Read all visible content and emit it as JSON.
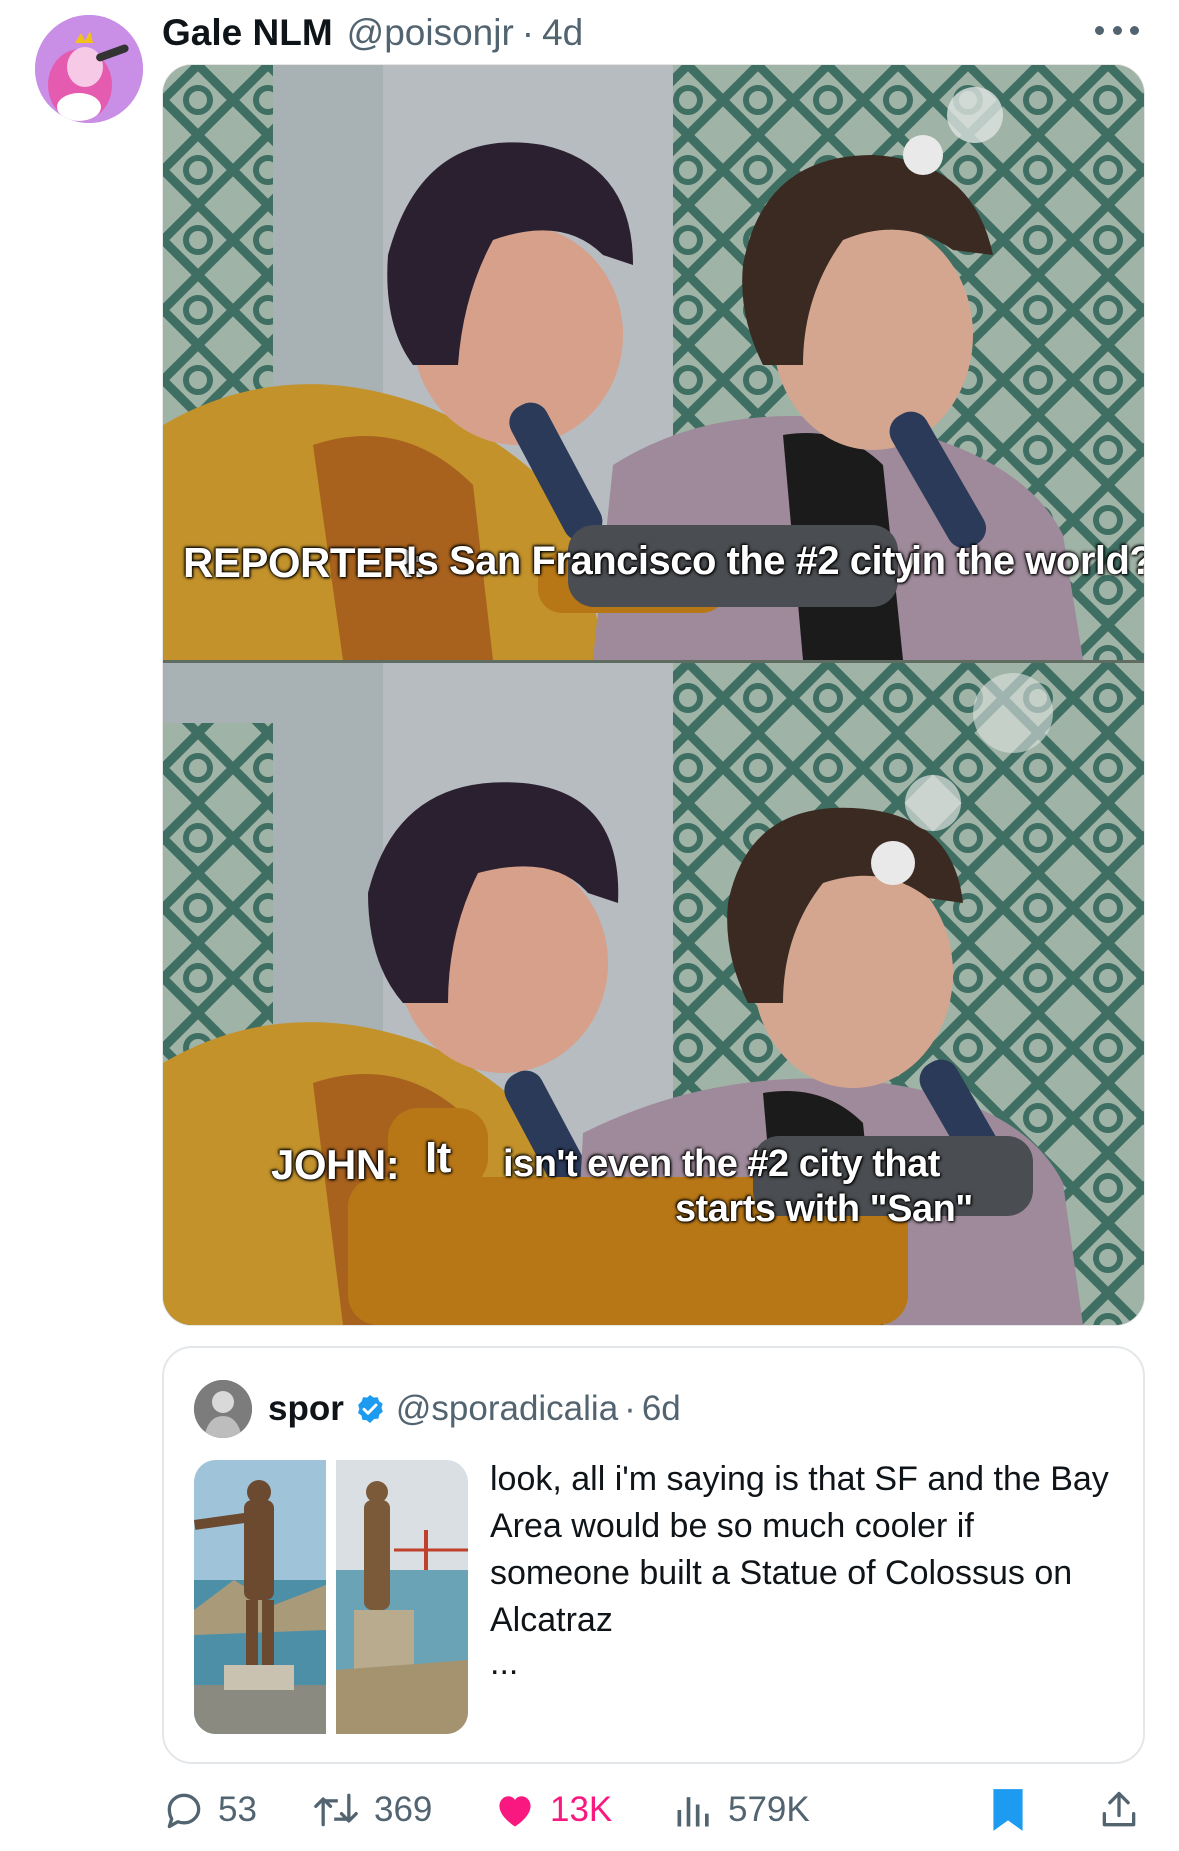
{
  "tweet": {
    "author_name": "Gale NLM",
    "author_handle": "@poisonjr",
    "separator": "·",
    "time": "4d"
  },
  "meme": {
    "top_caption": {
      "speaker": "REPORTER:",
      "part1": "Is San Francisco the #2 city",
      "part2": "in the world?"
    },
    "bottom_caption": {
      "speaker": "JOHN:",
      "word1": "It",
      "line1": "isn't even the #2 city that",
      "line2": "starts with \"San\""
    }
  },
  "quoted": {
    "author_name": "spor",
    "author_handle": "@sporadicalia",
    "separator": "·",
    "time": "6d",
    "text": "look, all i'm saying is that SF and the Bay Area would be so much cooler if someone built a Statue of Colossus on Alcatraz",
    "more": "..."
  },
  "actions": {
    "replies": "53",
    "reposts": "369",
    "likes": "13K",
    "views": "579K"
  },
  "colors": {
    "like": "#f91880",
    "bookmark": "#1d9bf0",
    "verified": "#1d9bf0",
    "muted": "#536471"
  }
}
